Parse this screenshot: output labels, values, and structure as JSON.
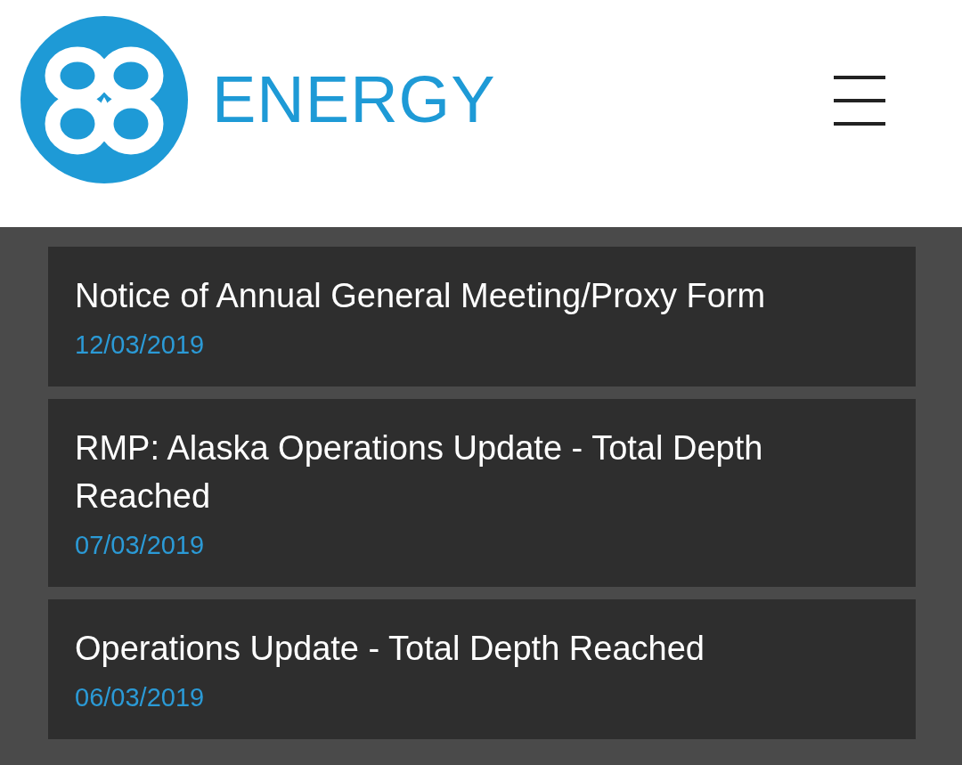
{
  "header": {
    "brand": "ENERGY"
  },
  "news": [
    {
      "title": "Notice of Annual General Meeting/Proxy Form",
      "date": "12/03/2019"
    },
    {
      "title": "RMP: Alaska Operations Update - Total Depth Reached",
      "date": "07/03/2019"
    },
    {
      "title": "Operations Update - Total Depth Reached",
      "date": "06/03/2019"
    }
  ]
}
